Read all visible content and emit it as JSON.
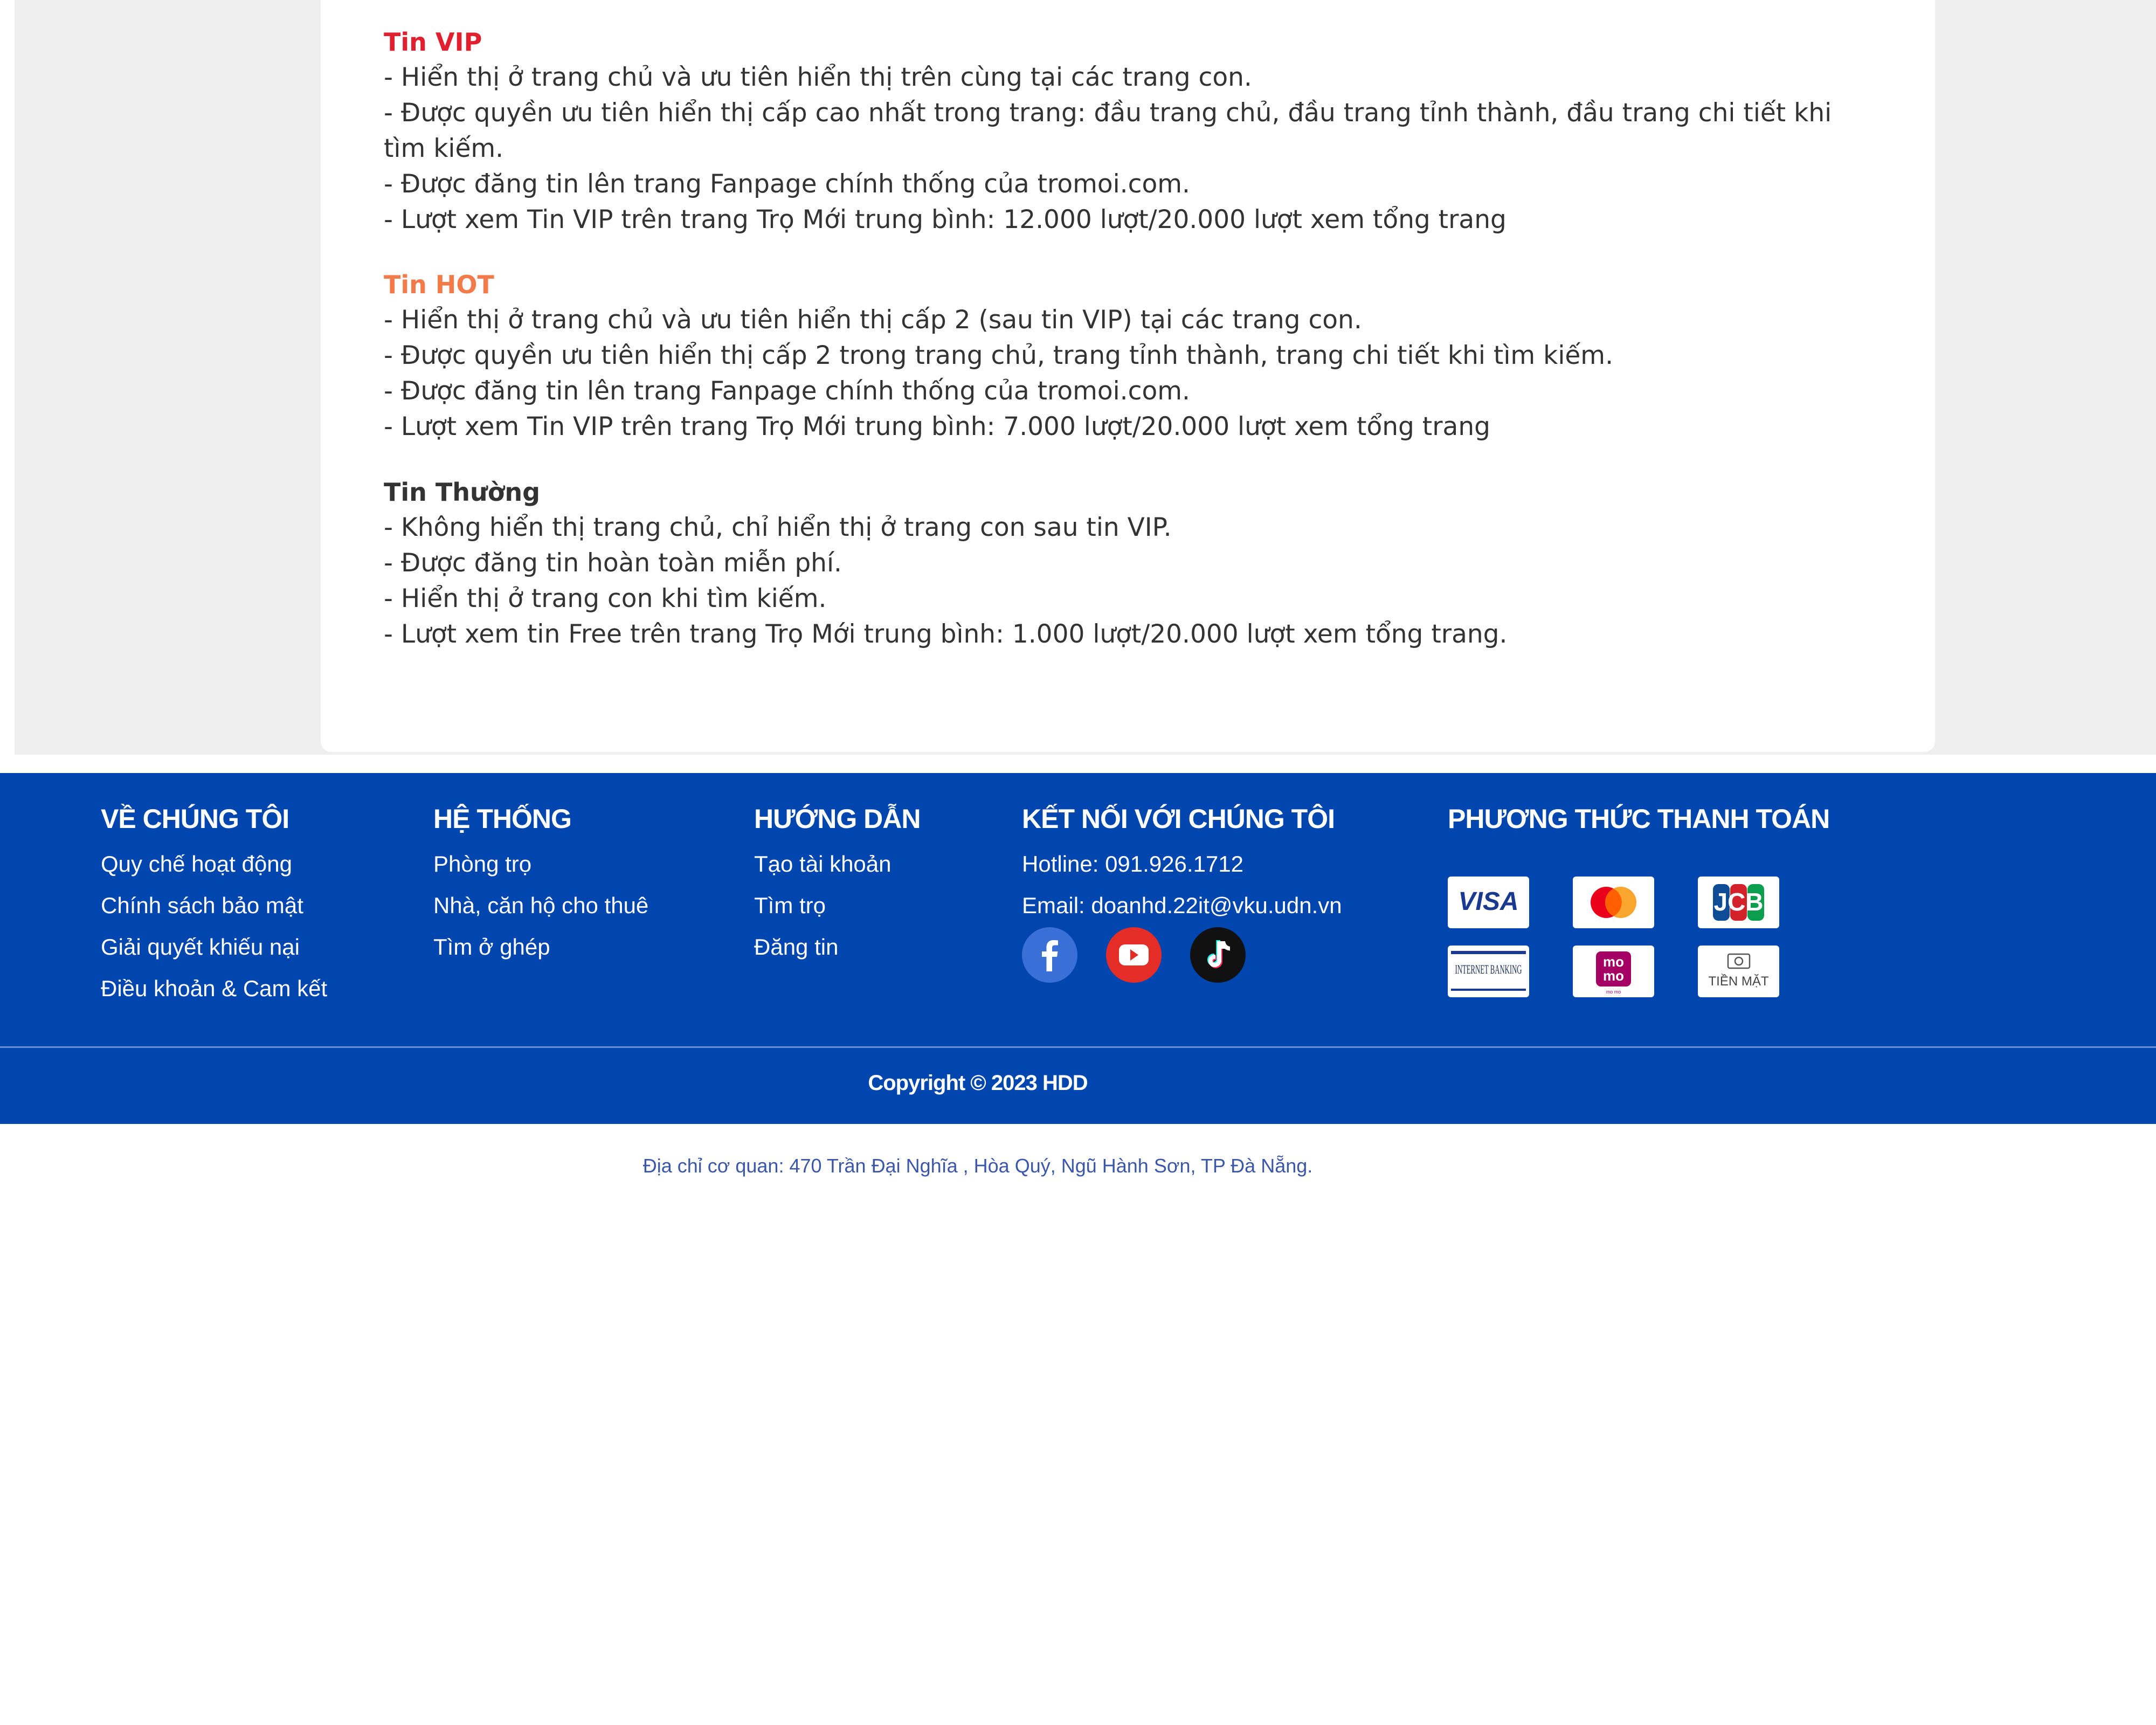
{
  "content": {
    "sections": [
      {
        "title": "Tin VIP",
        "title_color": "#e0202e",
        "lines": [
          "- Hiển thị ở trang chủ và ưu tiên hiển thị trên cùng tại các trang con.",
          "- Được quyền ưu tiên hiển thị cấp cao nhất trong trang: đầu trang chủ, đầu trang tỉnh thành, đầu trang chi tiết khi tìm kiếm.",
          "- Được đăng tin lên trang Fanpage chính thống của tromoi.com.",
          "- Lượt xem Tin VIP trên trang Trọ Mới trung bình: 12.000 lượt/20.000 lượt xem tổng trang"
        ]
      },
      {
        "title": "Tin HOT",
        "title_color": "#f37b4a",
        "lines": [
          "- Hiển thị ở trang chủ và ưu tiên hiển thị cấp 2 (sau tin VIP) tại các trang con.",
          "- Được quyền ưu tiên hiển thị cấp 2 trong trang chủ, trang tỉnh thành, trang chi tiết khi tìm kiếm.",
          "- Được đăng tin lên trang Fanpage chính thống của tromoi.com.",
          "- Lượt xem Tin VIP trên trang Trọ Mới trung bình: 7.000 lượt/20.000 lượt xem tổng trang"
        ]
      },
      {
        "title": "Tin Thường",
        "title_color": "#333333",
        "lines": [
          "- Không hiển thị trang chủ, chỉ hiển thị ở trang con sau tin VIP.",
          "- Được đăng tin hoàn toàn miễn phí.",
          "- Hiển thị ở trang con khi tìm kiếm.",
          "- Lượt xem tin Free trên trang Trọ Mới trung bình: 1.000 lượt/20.000 lượt xem tổng trang."
        ]
      }
    ]
  },
  "footer": {
    "colors": {
      "background": "#0046ae",
      "text": "#ffffff"
    },
    "about": {
      "heading": "VỀ CHÚNG TÔI",
      "links": [
        "Quy chế hoạt động",
        "Chính sách bảo mật",
        "Giải quyết khiếu nại",
        "Điều khoản & Cam kết"
      ]
    },
    "system": {
      "heading": "HỆ THỐNG",
      "links": [
        "Phòng trọ",
        "Nhà, căn hộ cho thuê",
        "Tìm ở ghép"
      ]
    },
    "guide": {
      "heading": "HƯỚNG DẪN",
      "links": [
        "Tạo tài khoản",
        "Tìm trọ",
        "Đăng tin"
      ]
    },
    "contact": {
      "heading": "KẾT NỐI VỚI CHÚNG TÔI",
      "hotline": "Hotline: 091.926.1712",
      "email": "Email: doanhd.22it@vku.udn.vn",
      "social": [
        "facebook-icon",
        "youtube-icon",
        "tiktok-icon"
      ]
    },
    "payment": {
      "heading": "PHƯƠNG THỨC THANH TOÁN",
      "methods": [
        "VISA",
        "mastercard",
        "JCB",
        "INTERNET BANKING",
        "mo mo",
        "TIỀN MẶT"
      ]
    },
    "copyright": "Copyright © 2023 HDD"
  },
  "address": "Địa chỉ cơ quan: 470 Trần Đại Nghĩa , Hòa Quý, Ngũ Hành Sơn, TP Đà Nẵng."
}
